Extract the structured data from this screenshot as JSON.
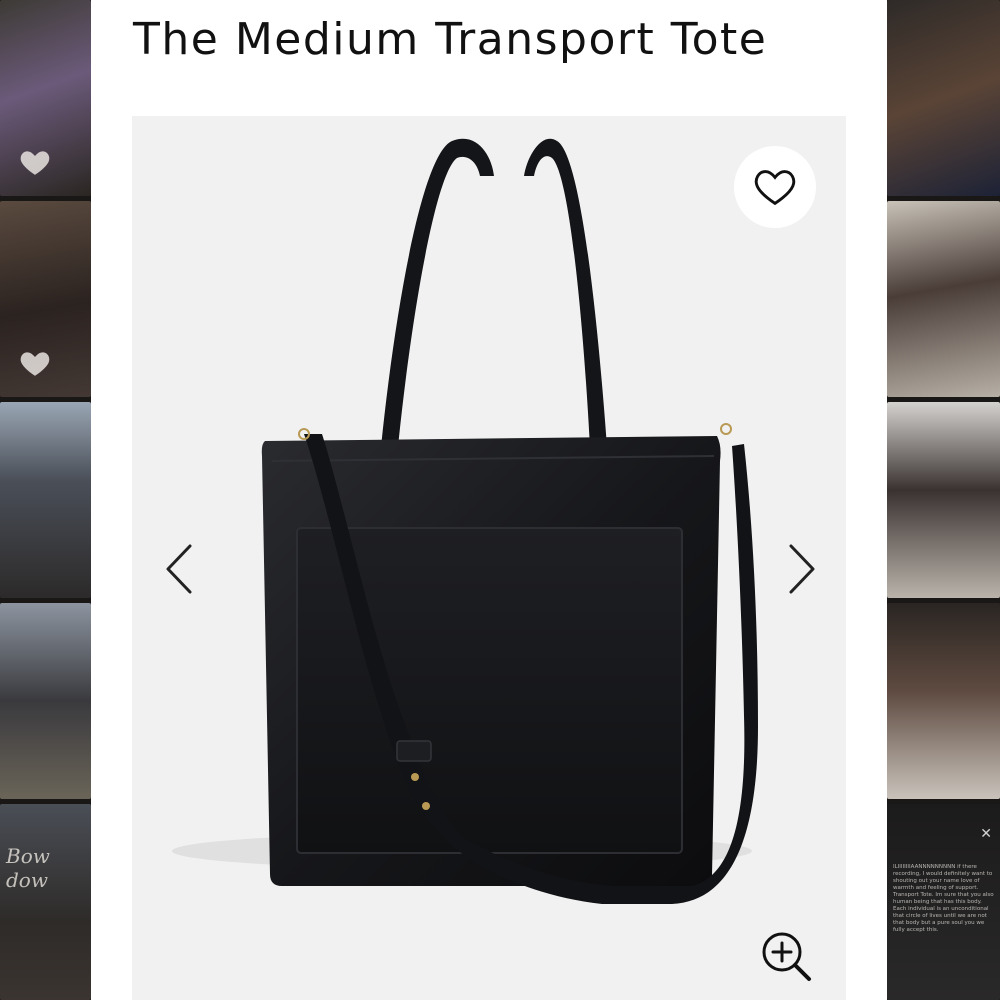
{
  "product": {
    "title": "The Medium Transport Tote",
    "image_alt": "black leather tote bag with detachable crossbody strap"
  },
  "viewer": {
    "favorite_icon": "heart-outline-icon",
    "prev_icon": "chevron-left-icon",
    "next_icon": "chevron-right-icon",
    "zoom_icon": "zoom-in-icon"
  },
  "background": {
    "left_script_text": "Bow dow",
    "right_caption": "ILIIIIIIIIAANNNNNNNNN if there recording, I would definitely want to shouting out your name love of warmth and feeling of support. Transport Tote. Im sure that you also human being that has this body. Each individual is an unconditional that circle of lives until we are not that body but a pure soul you we fully accept this."
  }
}
